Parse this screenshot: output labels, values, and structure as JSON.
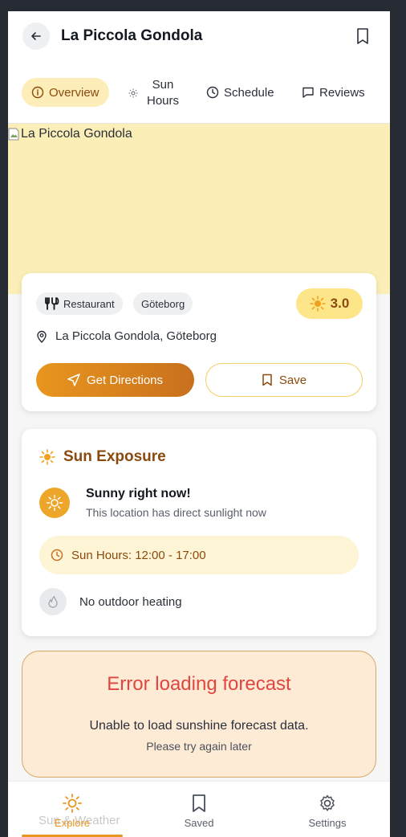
{
  "header": {
    "title": "La Piccola Gondola",
    "back_icon": "arrow-left-icon",
    "bookmark_icon": "bookmark-icon"
  },
  "tabs": [
    {
      "label": "Overview",
      "icon": "info-icon",
      "active": true
    },
    {
      "label_line1": "Sun",
      "label_line2": "Hours",
      "icon": "sun-icon",
      "active": false
    },
    {
      "label": "Schedule",
      "icon": "clock-icon",
      "active": false
    },
    {
      "label": "Reviews",
      "icon": "comment-icon",
      "active": false
    }
  ],
  "hero": {
    "alt_text": "La Piccola Gondola",
    "background": "#fbefb7"
  },
  "info_card": {
    "type_chip": "Restaurant",
    "type_icon": "utensils-icon",
    "city_chip": "Göteborg",
    "rating": "3.0",
    "address": "La Piccola Gondola, Göteborg",
    "directions_label": "Get Directions",
    "save_label": "Save"
  },
  "sun_exposure": {
    "title": "Sun Exposure",
    "status_heading": "Sunny right now!",
    "status_sub": "This location has direct sunlight now",
    "hours_label": "Sun Hours: 12:00 - 17:00",
    "heating_label": "No outdoor heating"
  },
  "error": {
    "title": "Error loading forecast",
    "message": "Unable to load sunshine forecast data.",
    "sub": "Please try again later"
  },
  "bottom_nav": {
    "items": [
      {
        "label": "Explore",
        "icon": "sun-icon",
        "active": true
      },
      {
        "label": "Saved",
        "icon": "bookmark-icon",
        "active": false
      },
      {
        "label": "Settings",
        "icon": "gear-icon",
        "active": false
      }
    ],
    "ghost_text": "Sun & Weather"
  },
  "colors": {
    "accent": "#e8961f",
    "accent_dark": "#8a4a0e",
    "error": "#e0463f"
  }
}
